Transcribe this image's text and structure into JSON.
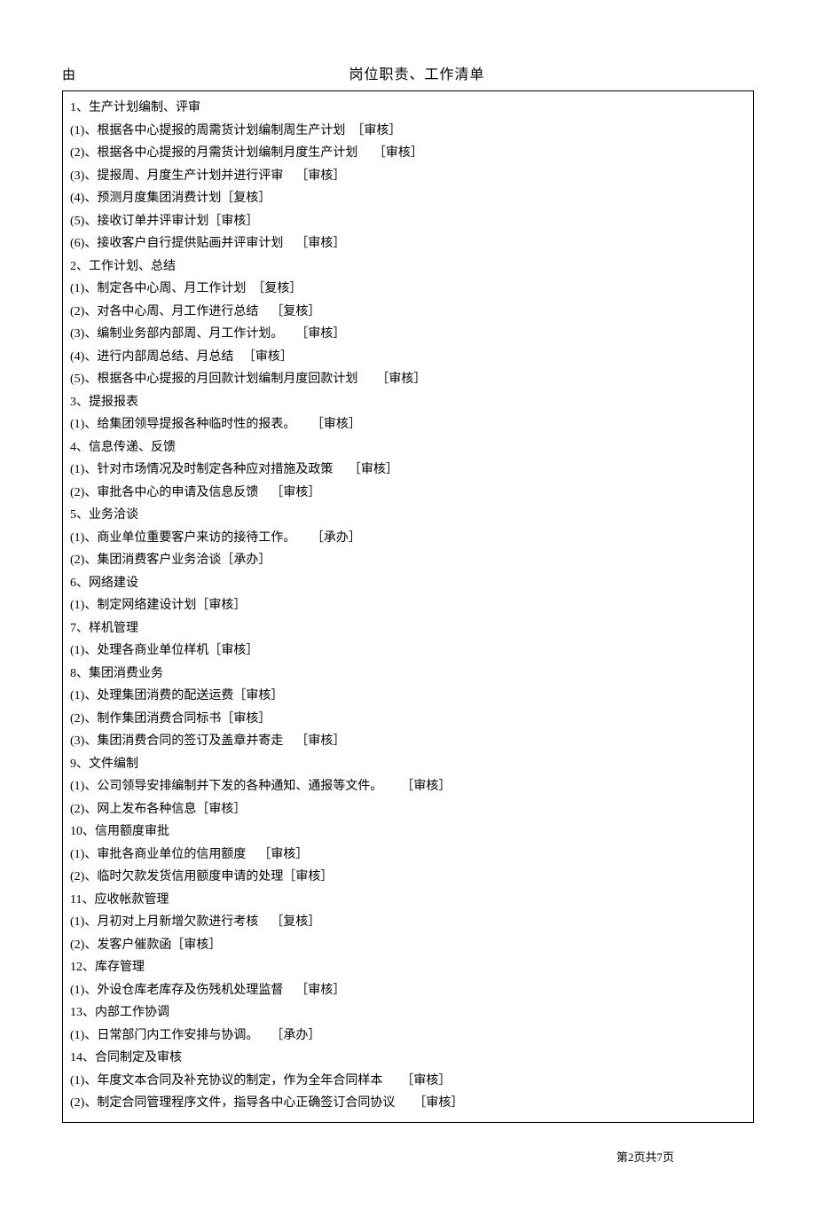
{
  "header": {
    "left": "由",
    "center": "岗位职责、工作清单"
  },
  "lines": [
    "1、生产计划编制、评审",
    "(1)、根据各中心提报的周需货计划编制周生产计划  ［审核］",
    "(2)、根据各中心提报的月需货计划编制月度生产计划     ［审核］",
    "(3)、提报周、月度生产计划并进行评审    ［审核］",
    "(4)、预测月度集团消费计划［复核］",
    "(5)、接收订单并评审计划［审核］",
    "(6)、接收客户自行提供贴画并评审计划    ［审核］",
    "2、工作计划、总结",
    "(1)、制定各中心周、月工作计划  ［复核］",
    "(2)、对各中心周、月工作进行总结    ［复核］",
    "(3)、编制业务部内部周、月工作计划。    ［审核］",
    "(4)、进行内部周总结、月总结   ［审核］",
    "(5)、根据各中心提报的月回款计划编制月度回款计划      ［审核］",
    "3、提报报表",
    "(1)、给集团领导提报各种临时性的报表。     ［审核］",
    "4、信息传递、反馈",
    "(1)、针对市场情况及时制定各种应对措施及政策     ［审核］",
    "(2)、审批各中心的申请及信息反馈    ［审核］",
    "5、业务洽谈",
    "(1)、商业单位重要客户来访的接待工作。     ［承办］",
    "(2)、集团消费客户业务洽谈［承办］",
    "6、网络建设",
    "(1)、制定网络建设计划［审核］",
    "7、样机管理",
    "(1)、处理各商业单位样机［审核］",
    "8、集团消费业务",
    "(1)、处理集团消费的配送运费［审核］",
    "(2)、制作集团消费合同标书［审核］",
    "(3)、集团消费合同的签订及盖章并寄走    ［审核］",
    "9、文件编制",
    "(1)、公司领导安排编制并下发的各种通知、通报等文件。      ［审核］",
    "(2)、网上发布各种信息［审核］",
    "10、信用额度审批",
    "(1)、审批各商业单位的信用额度    ［审核］",
    "(2)、临时欠款发货信用额度申请的处理［审核］",
    "11、应收帐款管理",
    "(1)、月初对上月新增欠款进行考核    ［复核］",
    "(2)、发客户催款函［审核］",
    "12、库存管理",
    "(1)、外设仓库老库存及伤残机处理监督    ［审核］",
    "13、内部工作协调",
    "(1)、日常部门内工作安排与协调。    ［承办］",
    "14、合同制定及审核",
    "(1)、年度文本合同及补充协议的制定，作为全年合同样本      ［审核］",
    "(2)、制定合同管理程序文件，指导各中心正确签订合同协议      ［审核］"
  ],
  "footer": "第2页共7页"
}
